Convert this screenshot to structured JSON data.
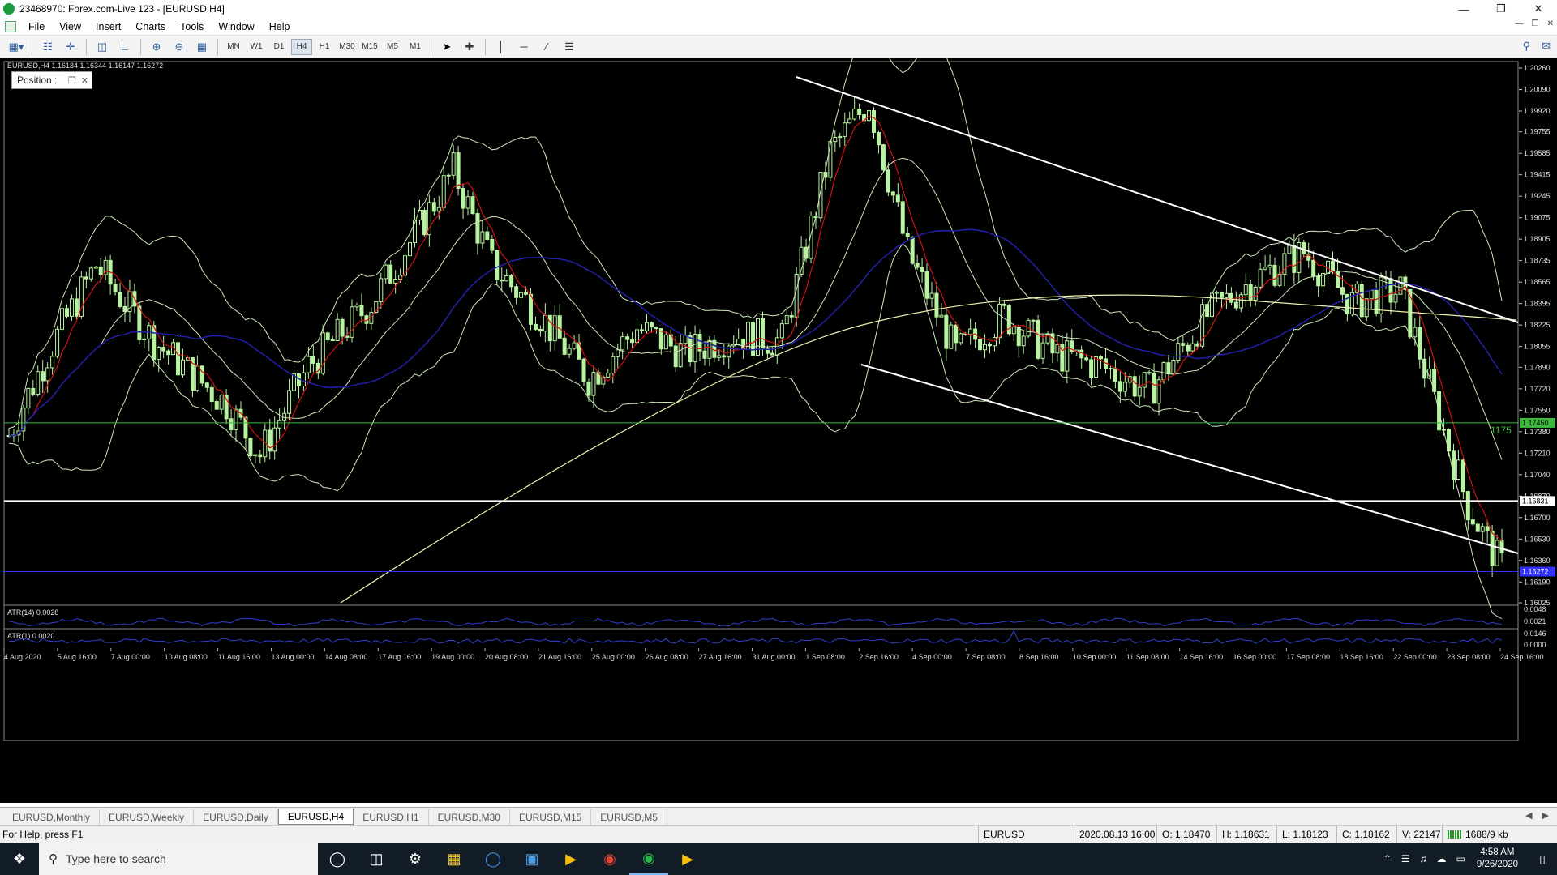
{
  "window": {
    "title": "23468970: Forex.com-Live 123 - [EURUSD,H4]"
  },
  "menu": [
    "File",
    "View",
    "Insert",
    "Charts",
    "Tools",
    "Window",
    "Help"
  ],
  "toolbar": {
    "timeframes": [
      "MN",
      "W1",
      "D1",
      "H4",
      "H1",
      "M30",
      "M15",
      "M5",
      "M1"
    ],
    "active_timeframe": "H4"
  },
  "chart": {
    "info": "EURUSD,H4  1.16184 1.16344 1.16147 1.16272",
    "position_panel": "Position :",
    "atr14_label": "ATR(14) 0.0028",
    "atr1_label": "ATR(1) 0.0020",
    "line_label": "1175",
    "colors": {
      "up": "#b8f5a0",
      "bb": "#cfe8b9",
      "ma_red": "#d01010",
      "ma_blue": "#2020a8",
      "ma_yellow": "#f0f0b0",
      "channel": "#ffffff",
      "hline_green": "#3dba3d",
      "hline_white": "#ffffff",
      "hline_blue": "#3030ff",
      "atr": "#3040d0"
    },
    "price_ticks": [
      "1.20260",
      "1.20090",
      "1.19920",
      "1.19755",
      "1.19585",
      "1.19415",
      "1.19245",
      "1.19075",
      "1.18905",
      "1.18735",
      "1.18565",
      "1.18395",
      "1.18225",
      "1.18055",
      "1.17890",
      "1.17720",
      "1.17550",
      "1.17380",
      "1.17210",
      "1.17040",
      "1.16870",
      "1.16700",
      "1.16530",
      "1.16360",
      "1.16190",
      "1.16025"
    ],
    "price_tags": [
      "1.17450",
      "1.16831",
      "1.16272"
    ],
    "atr14_ticks": [
      "0.0048",
      "0.0021"
    ],
    "atr1_ticks": [
      "0.0146",
      "0.0000"
    ],
    "time_ticks": [
      "4 Aug 2020",
      "5 Aug 16:00",
      "7 Aug 00:00",
      "10 Aug 08:00",
      "11 Aug 16:00",
      "13 Aug 00:00",
      "14 Aug 08:00",
      "17 Aug 16:00",
      "19 Aug 00:00",
      "20 Aug 08:00",
      "21 Aug 16:00",
      "25 Aug 00:00",
      "26 Aug 08:00",
      "27 Aug 16:00",
      "31 Aug 00:00",
      "1 Sep 08:00",
      "2 Sep 16:00",
      "4 Sep 00:00",
      "7 Sep 08:00",
      "8 Sep 16:00",
      "10 Sep 00:00",
      "11 Sep 08:00",
      "14 Sep 16:00",
      "16 Sep 00:00",
      "17 Sep 08:00",
      "18 Sep 16:00",
      "22 Sep 00:00",
      "23 Sep 08:00",
      "24 Sep 16:00"
    ]
  },
  "tabs": [
    "EURUSD,Monthly",
    "EURUSD,Weekly",
    "EURUSD,Daily",
    "EURUSD,H4",
    "EURUSD,H1",
    "EURUSD,M30",
    "EURUSD,M15",
    "EURUSD,M5"
  ],
  "active_tab": "EURUSD,H4",
  "status": {
    "help": "For Help, press F1",
    "symbol": "EURUSD",
    "datetime": "2020.08.13 16:00",
    "open": "O: 1.18470",
    "high": "H: 1.18631",
    "low": "L: 1.18123",
    "close": "C: 1.18162",
    "volume": "V: 22147",
    "traffic": "1688/9 kb"
  },
  "taskbar": {
    "search_placeholder": "Type here to search",
    "time": "4:58 AM",
    "date": "9/26/2020"
  }
}
